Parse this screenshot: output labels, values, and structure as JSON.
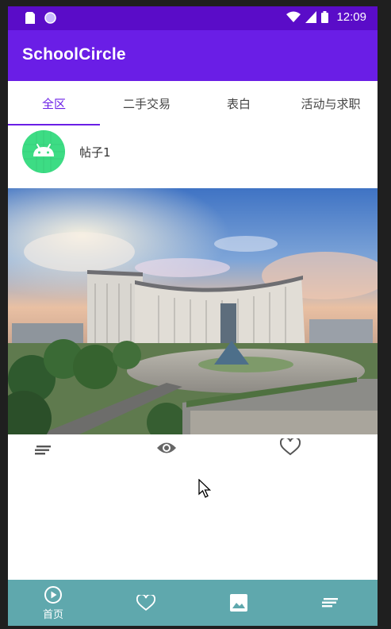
{
  "status_bar": {
    "time": "12:09"
  },
  "app_bar": {
    "title": "SchoolCircle"
  },
  "tabs": [
    {
      "label": "全区",
      "active": true
    },
    {
      "label": "二手交易",
      "active": false
    },
    {
      "label": "表白",
      "active": false
    },
    {
      "label": "活动与求职",
      "active": false
    }
  ],
  "post": {
    "title": "帖子1",
    "avatar_icon": "android-icon",
    "actions": [
      "menu-icon",
      "eye-icon",
      "heart-icon"
    ]
  },
  "bottom_nav": {
    "items": [
      {
        "icon": "play-circle-icon",
        "label": "首页"
      },
      {
        "icon": "heart-icon",
        "label": ""
      },
      {
        "icon": "image-icon",
        "label": ""
      },
      {
        "icon": "menu-icon",
        "label": ""
      }
    ]
  },
  "colors": {
    "status_bar": "#5a0cc8",
    "app_bar": "#6a1ee6",
    "tab_active": "#6a1ee6",
    "bottom_nav": "#5fa8ad",
    "avatar": "#3ddc84"
  }
}
